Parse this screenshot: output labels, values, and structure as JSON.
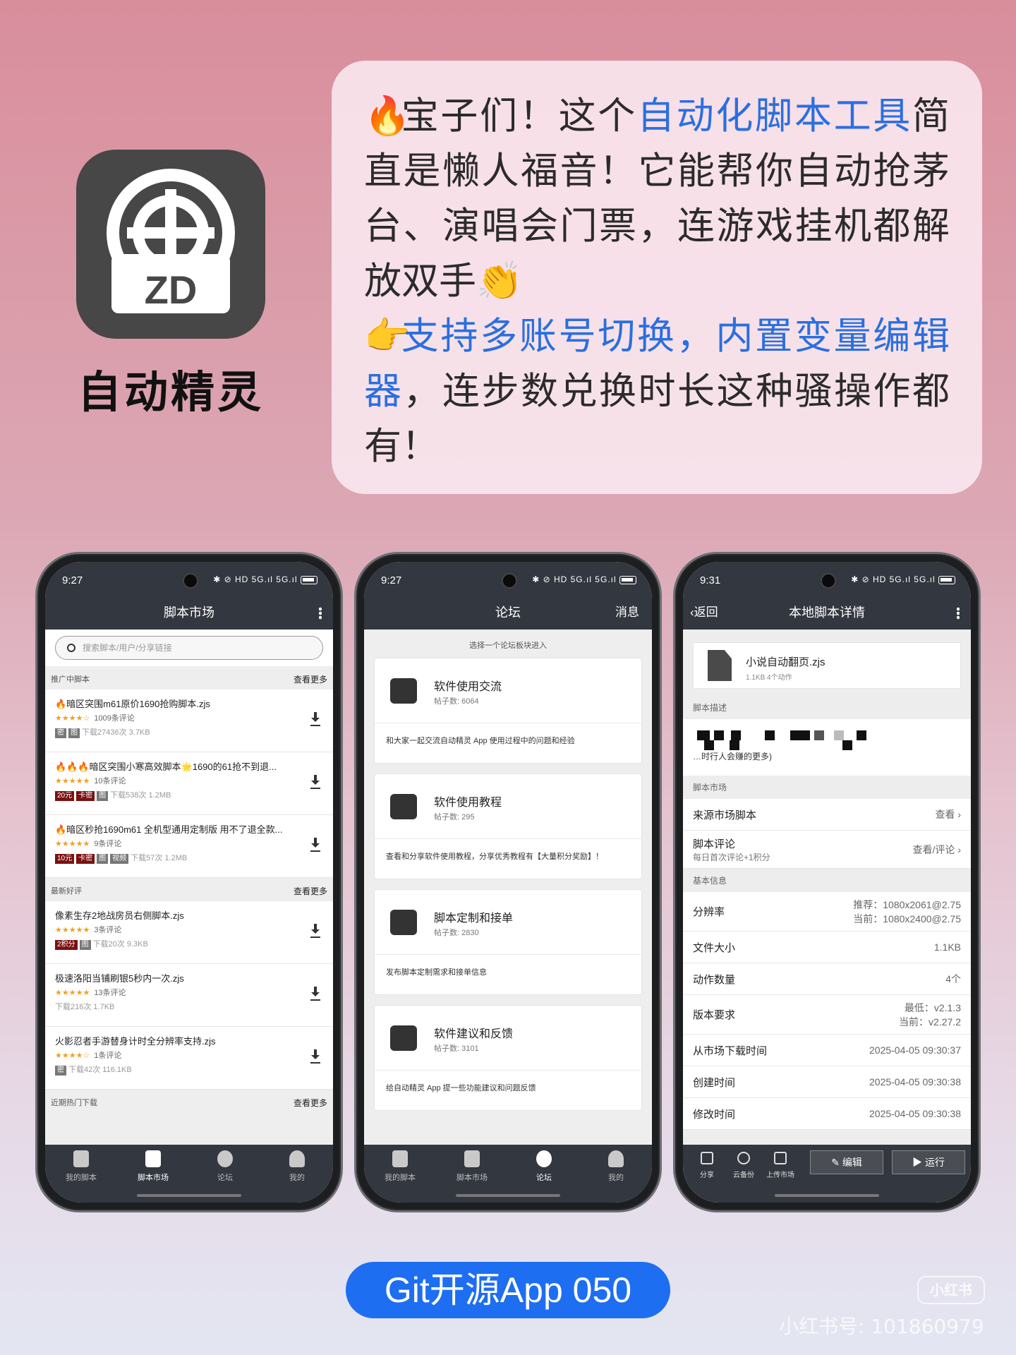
{
  "app": {
    "name": "自动精灵",
    "icon_label": "ZD"
  },
  "bubble": {
    "line1_pre": "宝子们！这个",
    "line1_link": "自动化脚本工具",
    "line1_post": "简直是懒人福音！它能帮你自动抢茅台、演唱会门票，连游戏挂机都解放双手",
    "line2_link": "支持多账号切换，内置变量编辑器",
    "line2_post": "，连步数兑换时长这种骚操作都有！",
    "fire_emoji": "🔥",
    "clap_emoji": "👏",
    "point_emoji": "👉"
  },
  "phone1": {
    "time": "9:27",
    "status_icons": "✱ ⊘ HD 5G.ıl 5G.ıl",
    "title": "脚本市场",
    "search_placeholder": "搜索脚本/用户/分享链接",
    "sections": [
      {
        "title": "推广中脚本",
        "more": "查看更多"
      },
      {
        "title": "最新好评",
        "more": "查看更多"
      },
      {
        "title": "近期热门下载",
        "more": "查看更多"
      }
    ],
    "promo": [
      {
        "title": "🔥暗区突围m61原价1690抢购脚本.zjs",
        "stars": "★★★★☆",
        "reviews": "1009条评论",
        "tags": [
          "密",
          "图"
        ],
        "meta": "下载27436次 3.7KB"
      },
      {
        "title": "🔥🔥🔥暗区突围小寒高效脚本🌟1690的61抢不到退...",
        "stars": "★★★★★",
        "reviews": "10条评论",
        "tags": [
          "20元",
          "卡密",
          "图"
        ],
        "meta": "下载538次 1.2MB"
      },
      {
        "title": "🔥暗区秒抢1690m61 全机型通用定制版 用不了退全款...",
        "stars": "★★★★★",
        "reviews": "9条评论",
        "tags": [
          "10元",
          "卡密",
          "图",
          "视频"
        ],
        "meta": "下载57次 1.2MB"
      }
    ],
    "latest": [
      {
        "title": "像素生存2地战房员右侧脚本.zjs",
        "stars": "★★★★★",
        "reviews": "3条评论",
        "tags": [
          "2积分",
          "图"
        ],
        "meta": "下载20次 9.3KB"
      },
      {
        "title": "极速洛阳当铺刷银5秒内一次.zjs",
        "stars": "★★★★★",
        "reviews": "13条评论",
        "tags": [],
        "meta": "下载216次 1.7KB"
      },
      {
        "title": "火影忍者手游替身计时全分辨率支持.zjs",
        "stars": "★★★★☆",
        "reviews": "1条评论",
        "tags": [
          "密"
        ],
        "meta": "下载42次 116.1KB"
      }
    ],
    "nav": [
      "我的脚本",
      "脚本市场",
      "论坛",
      "我的"
    ]
  },
  "phone2": {
    "time": "9:27",
    "status_icons": "✱ ⊘ HD 5G.ıl 5G.ıl",
    "title": "论坛",
    "right": "消息",
    "hint": "选择一个论坛板块进入",
    "boards": [
      {
        "name": "软件使用交流",
        "count": "帖子数: 6064",
        "desc": "和大家一起交流自动精灵 App 使用过程中的问题和经验"
      },
      {
        "name": "软件使用教程",
        "count": "帖子数: 295",
        "desc": "查看和分享软件使用教程，分享优秀教程有【大量积分奖励】！"
      },
      {
        "name": "脚本定制和接单",
        "count": "帖子数: 2830",
        "desc": "发布脚本定制需求和接单信息"
      },
      {
        "name": "软件建议和反馈",
        "count": "帖子数: 3101",
        "desc": "给自动精灵 App 提一些功能建议和问题反馈"
      }
    ],
    "nav": [
      "我的脚本",
      "脚本市场",
      "论坛",
      "我的"
    ]
  },
  "phone3": {
    "time": "9:31",
    "status_icons": "✱ ⊘ HD 5G.ıl 5G.ıl",
    "back": "返回",
    "title": "本地脚本详情",
    "file_name": "小说自动翻页.zjs",
    "file_meta": "1.1KB 4个动作",
    "desc_label": "脚本描述",
    "desc_tail": "…时行人会赚的更多)",
    "market_label": "脚本市场",
    "source": {
      "label": "来源市场脚本",
      "value": "查看"
    },
    "review": {
      "label": "脚本评论",
      "sub": "每日首次评论+1积分",
      "value": "查看/评论"
    },
    "basic_label": "基本信息",
    "rows": [
      {
        "label": "分辨率",
        "v1": "推荐：1080x2061@2.75",
        "v2": "当前：1080x2400@2.75"
      },
      {
        "label": "文件大小",
        "v1": "1.1KB"
      },
      {
        "label": "动作数量",
        "v1": "4个"
      },
      {
        "label": "版本要求",
        "v1": "最低：v2.1.3",
        "v2": "当前：v2.27.2"
      },
      {
        "label": "从市场下载时间",
        "v1": "2025-04-05 09:30:37"
      },
      {
        "label": "创建时间",
        "v1": "2025-04-05 09:30:38"
      },
      {
        "label": "修改时间",
        "v1": "2025-04-05 09:30:38"
      }
    ],
    "actions": [
      "分享",
      "云备份",
      "上传市场"
    ],
    "edit": "编辑",
    "run": "运行"
  },
  "footer": {
    "pill": "Git开源App 050",
    "wm_logo": "小红书",
    "wm_id": "小红书号: 101860979"
  }
}
